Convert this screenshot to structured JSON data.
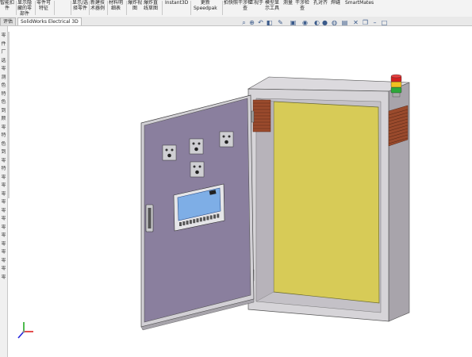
{
  "ribbon": {
    "items": [
      "智能扣\n件",
      "显示隐\n藏的零\n部件",
      "零件可\n特征",
      "显示/选\n择零件",
      "新建技\n术器例",
      "材料明\n细表",
      "爆炸视\n图",
      "爆炸直\n线草图",
      "Instant3D",
      "更新\nSpeedpak",
      "拍快照",
      "干涉检\n查",
      "正视于",
      "模型显\n示工具",
      "测量",
      "干涉检\n查",
      "孔对齐",
      "焊缝",
      "SmartMates"
    ]
  },
  "tabs": [
    "评估",
    "SolidWorks Electrical 3D"
  ],
  "left_panel": {
    "chars": [
      "零",
      "件",
      "厂",
      "选",
      "零",
      "测",
      "色",
      "特",
      "色",
      "到",
      "颜",
      "零",
      "特",
      "色",
      "到",
      "零",
      "特",
      "零",
      "零",
      "零",
      "零",
      "零",
      "零",
      "零",
      "零",
      "零",
      "零",
      "零",
      "零",
      "零"
    ]
  },
  "view_toolbar": {
    "icons": [
      "zoom-fit-icon",
      "zoom-area-icon",
      "previous-view-icon",
      "section-view-icon",
      "dynamic-annotation-icon",
      "view-orientation-icon",
      "display-style-icon",
      "hide-show-icon",
      "edit-appearance-icon",
      "apply-scene-icon",
      "view-settings-icon",
      "close-icon",
      "restore-icon",
      "minimize-icon",
      "maximize-icon"
    ]
  },
  "colors": {
    "door_panel": "#8a7f9e",
    "cabinet_frame": "#d6d4d8",
    "back_plate": "#d7cb57",
    "vent": "#9a4a2c",
    "display": "#7eaee6",
    "beacon_red": "#d32020",
    "beacon_yellow": "#f0c020",
    "beacon_green": "#2da83a"
  }
}
